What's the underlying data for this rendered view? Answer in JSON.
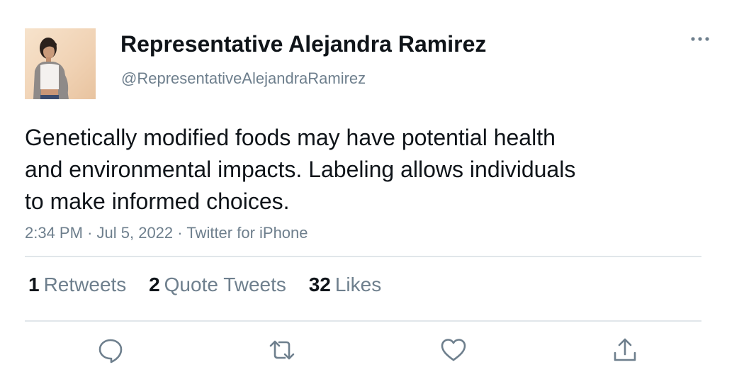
{
  "author": {
    "display_name": "Representative Alejandra Ramirez",
    "handle": "@RepresentativeAlejandraRamirez"
  },
  "tweet": {
    "text_lines": [
      "Genetically modified foods may have potential health",
      "and environmental impacts. Labeling allows individuals",
      "to make informed choices."
    ],
    "time": "2:34 PM",
    "separator": "·",
    "date": "Jul 5, 2022",
    "source": "Twitter for iPhone"
  },
  "stats": {
    "retweets_count": "1",
    "retweets_label": "Retweets",
    "quotes_count": "2",
    "quotes_label": "Quote Tweets",
    "likes_count": "32",
    "likes_label": "Likes"
  },
  "actions": {
    "icons": [
      "reply-icon",
      "retweet-icon",
      "like-icon",
      "share-icon"
    ]
  },
  "colors": {
    "text_primary": "#0f1419",
    "text_secondary": "#6e7f8d",
    "divider": "#e1e6ea"
  }
}
